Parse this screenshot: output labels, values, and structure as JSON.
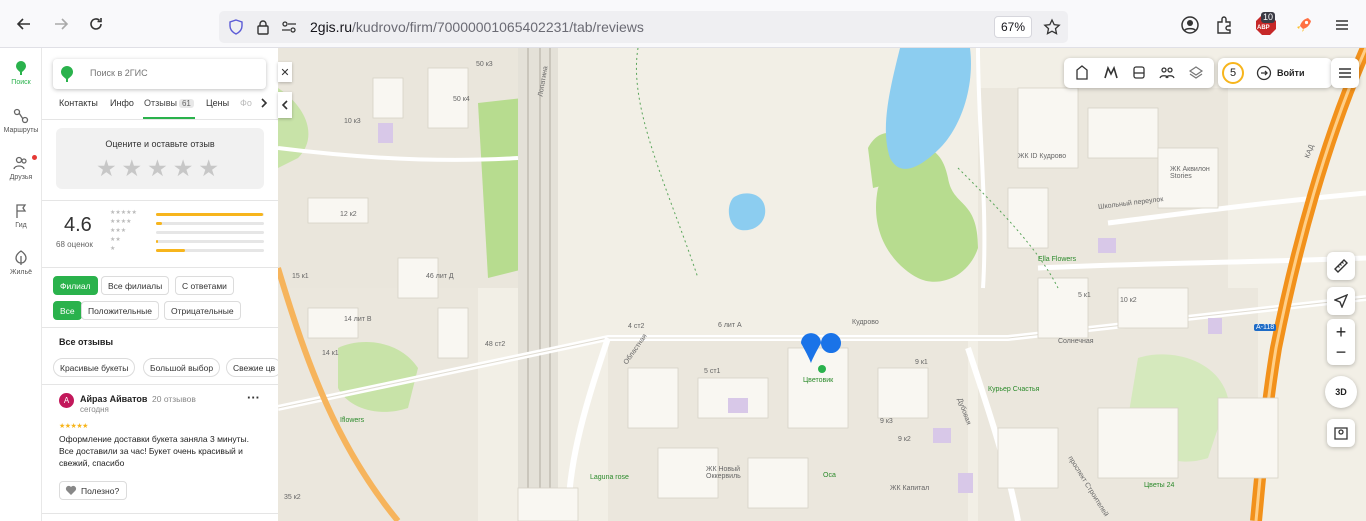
{
  "browser": {
    "url_host": "2gis.ru",
    "url_path": "/kudrovo/firm/70000001065402231/tab/reviews",
    "zoom": "67%",
    "extension_badge": "10",
    "extension_badge_sub": "ABP"
  },
  "rail": {
    "items": [
      {
        "label": "Поиск",
        "icon": "search-pin-icon",
        "color": "#2ab24c"
      },
      {
        "label": "Маршруты",
        "icon": "route-icon"
      },
      {
        "label": "Друзья",
        "icon": "friends-icon"
      },
      {
        "label": "Гид",
        "icon": "guide-flag-icon"
      },
      {
        "label": "Жильё",
        "icon": "housing-icon"
      }
    ]
  },
  "panel": {
    "search_placeholder": "Поиск в 2ГИС",
    "tabs": [
      {
        "label": "Контакты"
      },
      {
        "label": "Инфо"
      },
      {
        "label": "Отзывы",
        "count": "61"
      },
      {
        "label": "Цены"
      },
      {
        "label": "Фо"
      }
    ],
    "rate_prompt": "Оцените и оставьте отзыв",
    "rating": "4.6",
    "rating_count": "68 оценок",
    "distribution": [
      {
        "stars": "★★★★★",
        "fraction": 0.99
      },
      {
        "stars": "★★★★",
        "fraction": 0.06
      },
      {
        "stars": "★★★",
        "fraction": 0.0
      },
      {
        "stars": "★★",
        "fraction": 0.02
      },
      {
        "stars": "★",
        "fraction": 0.27
      }
    ],
    "filters_row1": [
      "Филиал",
      "Все филиалы",
      "С ответами"
    ],
    "filters_row2": [
      "Все",
      "Положительные",
      "Отрицательные"
    ],
    "all_reviews_title": "Все отзывы",
    "tags": [
      "Красивые букеты",
      "Большой выбор",
      "Свежие цв"
    ],
    "review": {
      "avatar_letter": "А",
      "author": "Айраз Айватов",
      "author_meta": "20 отзывов",
      "date": "сегодня",
      "stars": "★★★★★",
      "text": "Оформление доставки букета заняла 3 минуты. Все доставили за час! Букет очень красивый и свежий, спасибо",
      "useful_label": "Полезно?"
    }
  },
  "map": {
    "login_label": "Войти",
    "notifications_count": "5",
    "zoom_in": "+",
    "zoom_out": "−",
    "view_3d": "3D",
    "labels": {
      "tsvetovik": "Цветовик",
      "kudrovo": "Кудрово",
      "zhk_id": "ЖК ID Кудрово",
      "zhk_akvilon": "ЖК Аквилон Stories",
      "shkolny": "Школьный переулок",
      "ella": "Ella Flowers",
      "solnechnaya": "Солнечная",
      "kurier": "Курьер Счастья",
      "dubovaya": "Дубовая",
      "oblastnaya": "Областная",
      "iflowers": "Iflowers",
      "laguna": "Laguna rose",
      "zhk_novy": "ЖК Новый Оккервиль",
      "osa": "Оса",
      "zhk_kapital": "ЖК Капитал",
      "tsvety24": "Цветы 24",
      "stroiteley": "проспект Строителей",
      "a118": "А-118",
      "kad": "КАД",
      "lopatina": "Лопатина",
      "b6litA": "6 лит А",
      "b4st2": "4 ст2",
      "b5st1": "5 ст1",
      "b9k1": "9 к1",
      "b9k2": "9 к2",
      "b5k1": "5 к1",
      "b10k2": "10 к2",
      "b46litD": "46 лит Д",
      "b14litV": "14 лит В",
      "b48st2": "48 ст2",
      "b12k2": "12 к2",
      "b10k3": "10 к3",
      "b50k3": "50 к3",
      "b50k4": "50 к4",
      "b35k2": "35 к2",
      "b15k1": "15 к1",
      "b14k1": "14 к1",
      "b9k3": "9 к3"
    }
  },
  "colors": {
    "accent": "#2ab24c",
    "star": "#f7b51c",
    "highway": "#f2911b",
    "water": "#8ccdf0",
    "park": "#b7dc8f",
    "pin": "#1a73e8"
  }
}
